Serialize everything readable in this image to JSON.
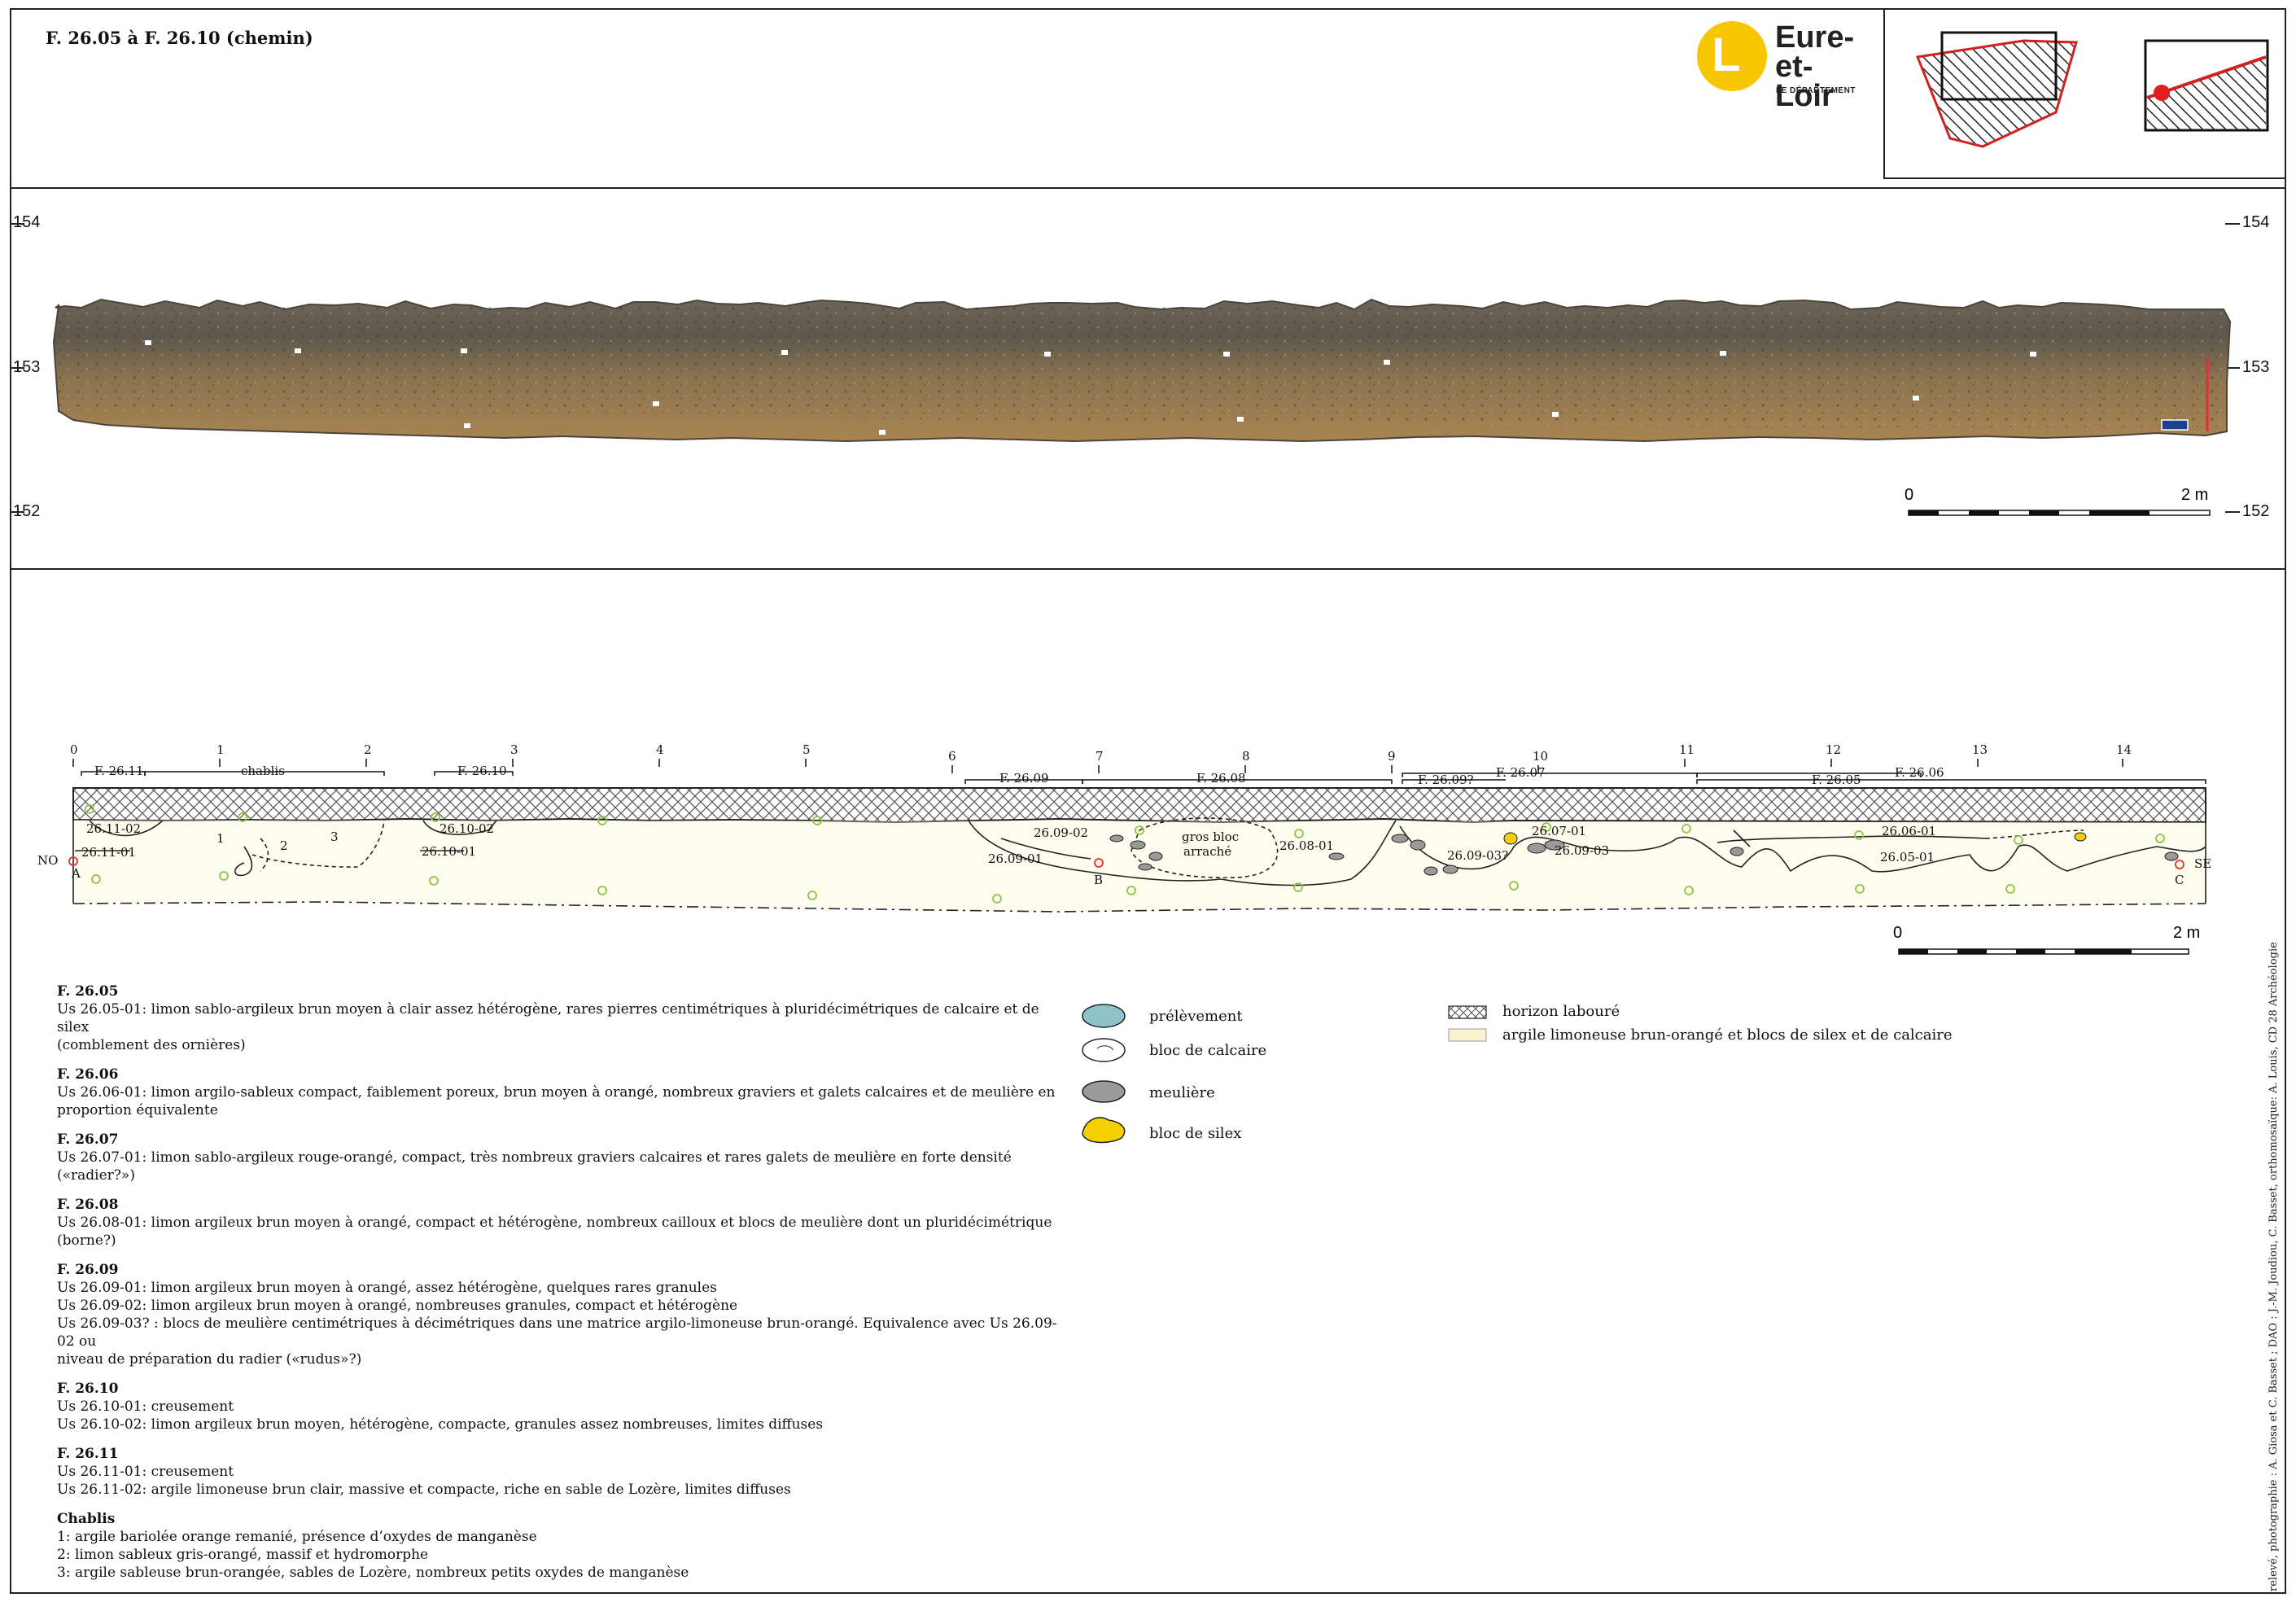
{
  "title": "F. 26.05 à F. 26.10 (chemin)",
  "logo": {
    "line1": "Eure-",
    "line2": "et-Loir",
    "line3": "LE DÉPARTEMENT",
    "color": "#f7c600"
  },
  "photo_section": {
    "altitudes": [
      "154",
      "153",
      "152"
    ],
    "scale": {
      "start": "0",
      "end": "2 m"
    }
  },
  "drawing": {
    "meters": [
      "0",
      "1",
      "2",
      "3",
      "4",
      "5",
      "6",
      "7",
      "8",
      "9",
      "10",
      "11",
      "12",
      "13",
      "14"
    ],
    "features_top": [
      "F. 26.11",
      "chablis",
      "F. 26.10",
      "F. 26.09",
      "F. 26.08",
      "F. 26.09?",
      "F. 26.07",
      "F. 26.05",
      "F. 26.06"
    ],
    "units": [
      "26.11-02",
      "26.11-01",
      "1",
      "2",
      "3",
      "26.10-02",
      "26.10-01",
      "26.09-02",
      "26.09-01",
      "gros bloc",
      "arraché",
      "26.08-01",
      "26.09-03?",
      "26.07-01",
      "26.09-03",
      "26.06-01",
      "26.05-01"
    ],
    "points": [
      "NO",
      "A",
      "B",
      "C",
      "SE"
    ],
    "scale": {
      "start": "0",
      "end": "2 m"
    }
  },
  "descriptions": [
    {
      "head": "F. 26.05",
      "lines": [
        "Us 26.05-01: limon sablo-argileux brun moyen à clair assez hétérogène, rares pierres centimétriques à pluridécimétriques de calcaire et de silex",
        "(comblement des ornières)"
      ]
    },
    {
      "head": "F. 26.06",
      "lines": [
        "Us 26.06-01: limon argilo-sableux compact, faiblement poreux, brun moyen à orangé, nombreux graviers et galets calcaires et de meulière en",
        "proportion équivalente"
      ]
    },
    {
      "head": "F. 26.07",
      "lines": [
        "Us 26.07-01: limon sablo-argileux rouge-orangé, compact, très nombreux graviers calcaires et rares galets de meulière en forte densité («radier?»)"
      ]
    },
    {
      "head": "F. 26.08",
      "lines": [
        "Us 26.08-01: limon argileux brun moyen à orangé, compact et hétérogène, nombreux cailloux et blocs de meulière dont un pluridécimétrique",
        "(borne?)"
      ]
    },
    {
      "head": "F. 26.09",
      "lines": [
        "Us 26.09-01: limon argileux brun moyen à orangé, assez hétérogène, quelques rares granules",
        "Us 26.09-02: limon argileux brun moyen à orangé, nombreuses granules, compact et hétérogène",
        "Us 26.09-03? : blocs de meulière centimétriques à décimétriques dans une matrice argilo-limoneuse brun-orangé. Equivalence avec Us 26.09-02 ou",
        "niveau de préparation du radier («rudus»?)"
      ]
    },
    {
      "head": "F. 26.10",
      "lines": [
        "Us 26.10-01: creusement",
        "Us 26.10-02: limon argileux brun moyen, hétérogène, compacte, granules assez nombreuses, limites diffuses"
      ]
    },
    {
      "head": "F. 26.11",
      "lines": [
        "Us 26.11-01: creusement",
        "Us 26.11-02: argile limoneuse brun clair, massive et compacte, riche en sable de Lozère, limites diffuses"
      ]
    },
    {
      "head": "Chablis",
      "lines": [
        "1: argile bariolée orange remanié, présence d’oxydes de manganèse",
        "2: limon sableux gris-orangé, massif et hydromorphe",
        "3: argile sableuse brun-orangée, sables de Lozère, nombreux petits oxydes de manganèse"
      ]
    }
  ],
  "key": {
    "prelevement": "prélèvement",
    "calcaire": "bloc de calcaire",
    "meuliere": "meulière",
    "silex": "bloc de silex",
    "laboure": "horizon labouré",
    "argile": "argile limoneuse brun-orangé et blocs de silex et de calcaire"
  },
  "credit": "relevé, photographie : A. Giosa et C. Basset ; DAO : J.-M. Joudiou, C. Basset, orthomosaïque: A. Louis,  CD 28 Archéologie",
  "colors": {
    "prelevement": "#8fc3cc",
    "meuliere": "#9a9a9a",
    "silex": "#f4d000",
    "argile": "#fbf3d0",
    "sample_dot": "#8cc63f",
    "point": "#e03030"
  }
}
